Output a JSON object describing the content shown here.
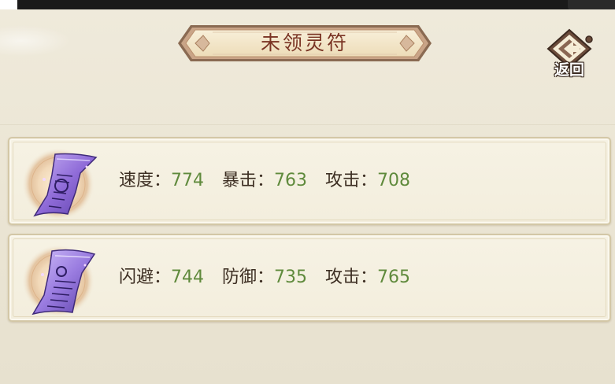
{
  "page": {
    "title": "未领灵符",
    "back_label": "返回"
  },
  "colors": {
    "background": "#ebe6d6",
    "stat_value": "#5f8a3c",
    "stat_label": "#3c2e22",
    "title_text": "#7a3424",
    "talisman_glow": "#8f6bd8"
  },
  "talismans": [
    {
      "icon": "purple-talisman-icon",
      "stats": [
        {
          "label": "速度：",
          "value": "774"
        },
        {
          "label": "暴击：",
          "value": "763"
        },
        {
          "label": "攻击：",
          "value": "708"
        }
      ]
    },
    {
      "icon": "purple-talisman-icon",
      "stats": [
        {
          "label": "闪避：",
          "value": "744"
        },
        {
          "label": "防御：",
          "value": "735"
        },
        {
          "label": "攻击：",
          "value": "765"
        }
      ]
    }
  ]
}
